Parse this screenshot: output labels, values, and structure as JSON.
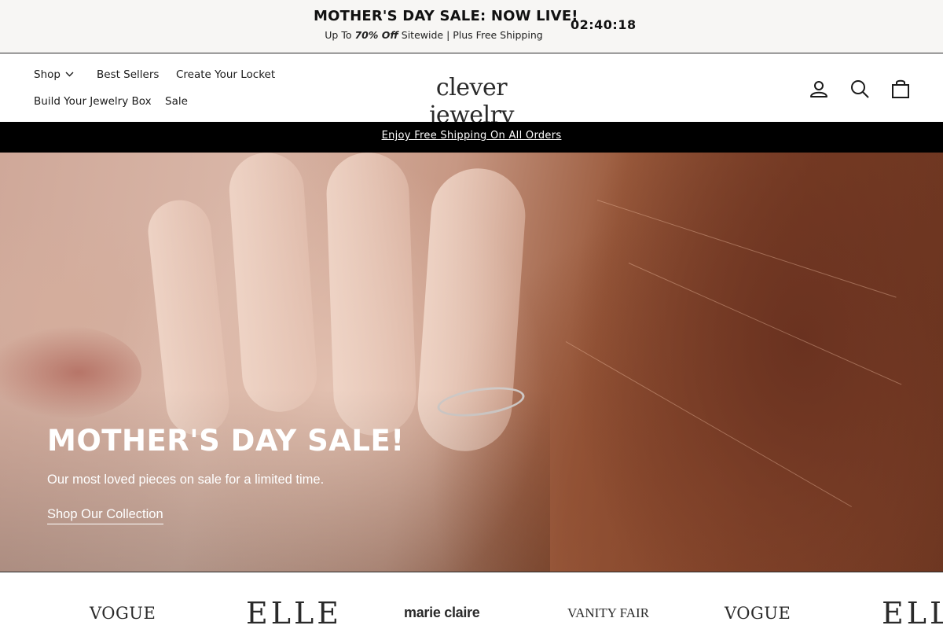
{
  "announcement": {
    "title": "MOTHER'S DAY SALE: NOW LIVE!",
    "sub_prefix": "Up To ",
    "sub_bold": "70% Off",
    "sub_suffix": " Sitewide | Plus Free Shipping",
    "timer": "02:40:18"
  },
  "nav": {
    "shop": "Shop",
    "best_sellers": "Best Sellers",
    "create_locket": "Create Your Locket",
    "build_box": "Build Your Jewelry Box",
    "sale": "Sale"
  },
  "logo": "clever jewelry",
  "header_icons": [
    "user-icon",
    "search-icon",
    "cart-icon"
  ],
  "shipping_banner": "Enjoy Free Shipping On All Orders",
  "hero": {
    "title": "MOTHER'S DAY SALE!",
    "subtitle": "Our most loved pieces on sale for a limited time.",
    "cta": "Shop Our Collection"
  },
  "press_logos": [
    "VOGUE",
    "ELLE",
    "marie claire",
    "VANITY FAIR",
    "VOGUE",
    "ELLE"
  ]
}
